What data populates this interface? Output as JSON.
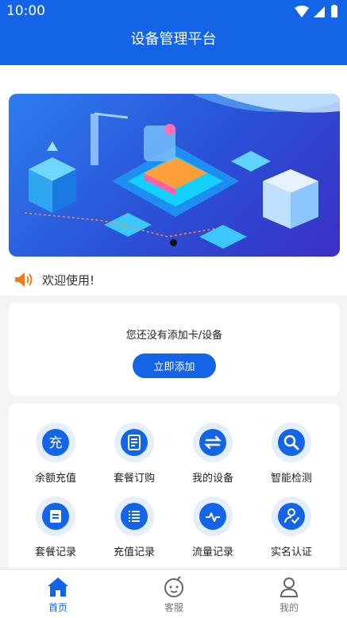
{
  "status_bar": {
    "time": "10:00"
  },
  "app_bar": {
    "title": "设备管理平台"
  },
  "notice": {
    "text": "欢迎使用!"
  },
  "empty_card": {
    "message": "您还没有添加卡/设备",
    "button_label": "立即添加"
  },
  "menu": {
    "items": [
      {
        "label": "余额充值",
        "icon": "charge-icon"
      },
      {
        "label": "套餐订购",
        "icon": "order-icon"
      },
      {
        "label": "我的设备",
        "icon": "devices-icon"
      },
      {
        "label": "智能检测",
        "icon": "search-icon"
      },
      {
        "label": "套餐记录",
        "icon": "package-record-icon"
      },
      {
        "label": "充值记录",
        "icon": "list-icon"
      },
      {
        "label": "流量记录",
        "icon": "traffic-icon"
      },
      {
        "label": "实名认证",
        "icon": "verify-icon"
      }
    ],
    "charge_glyph": "充"
  },
  "tabs": [
    {
      "label": "首页",
      "icon": "home-icon",
      "active": true
    },
    {
      "label": "客服",
      "icon": "service-icon",
      "active": false
    },
    {
      "label": "我的",
      "icon": "profile-icon",
      "active": false
    }
  ],
  "colors": {
    "primary": "#1464e8",
    "notice_icon": "#f07a1c",
    "halo": "#e4eefd"
  }
}
